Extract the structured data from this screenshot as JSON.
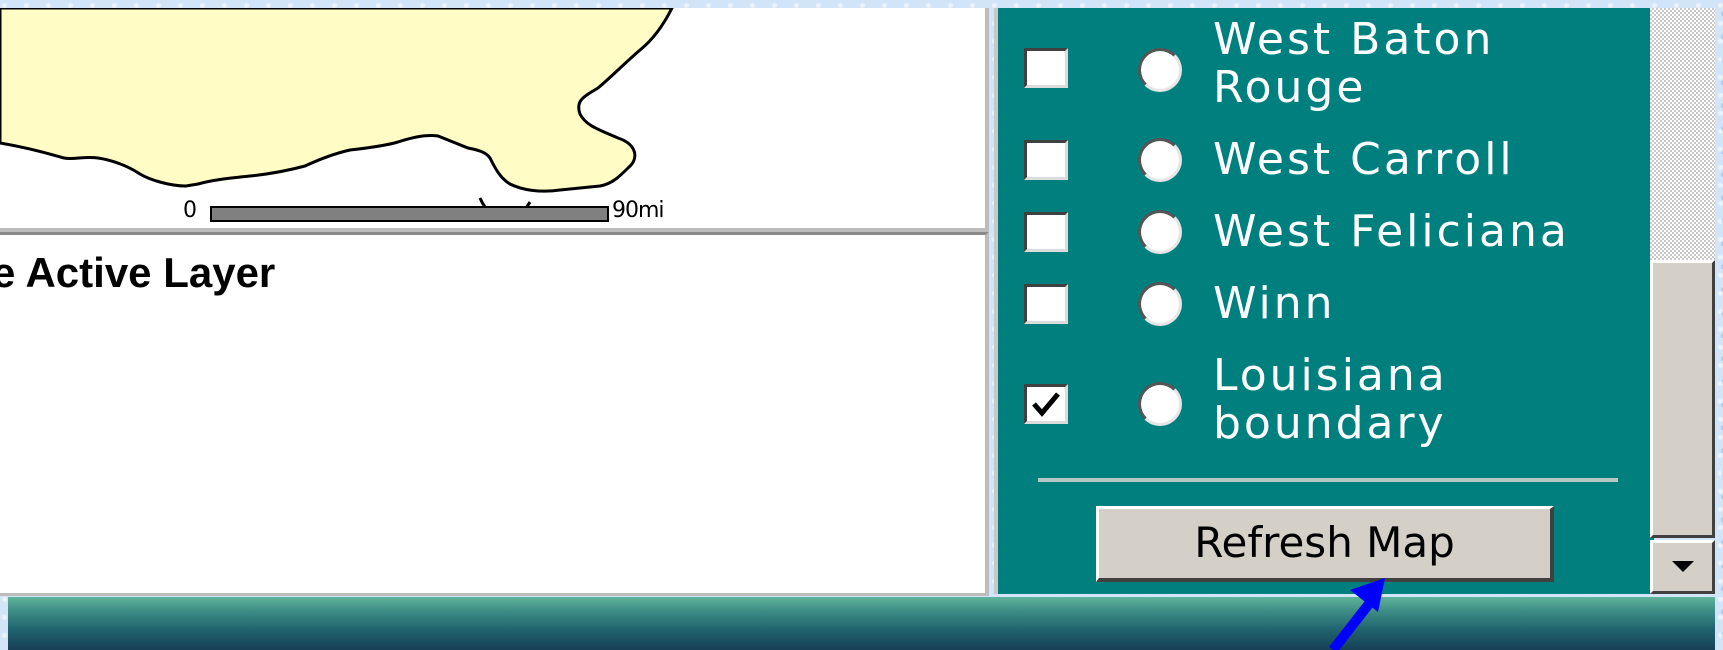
{
  "map": {
    "scale_start": "0",
    "scale_end": "90mi",
    "colors": {
      "land": "#fffcc5",
      "outline": "#000000"
    }
  },
  "info": {
    "active_layer_label": "e Active Layer"
  },
  "legend": {
    "background": "#007f7f",
    "items": [
      {
        "label_line1": "West Baton",
        "label_line2": "Rouge",
        "checked": false
      },
      {
        "label_line1": "West Carroll",
        "label_line2": "",
        "checked": false
      },
      {
        "label_line1": "West Feliciana",
        "label_line2": "",
        "checked": false
      },
      {
        "label_line1": "Winn",
        "label_line2": "",
        "checked": false
      },
      {
        "label_line1": "Louisiana",
        "label_line2": "boundary",
        "checked": true
      }
    ],
    "refresh_label": "Refresh Map"
  },
  "scrollbar": {
    "down_icon": "triangle-down-icon"
  },
  "annotation": {
    "icon": "blue-pointer-arrow-icon",
    "color": "#0000ff"
  }
}
